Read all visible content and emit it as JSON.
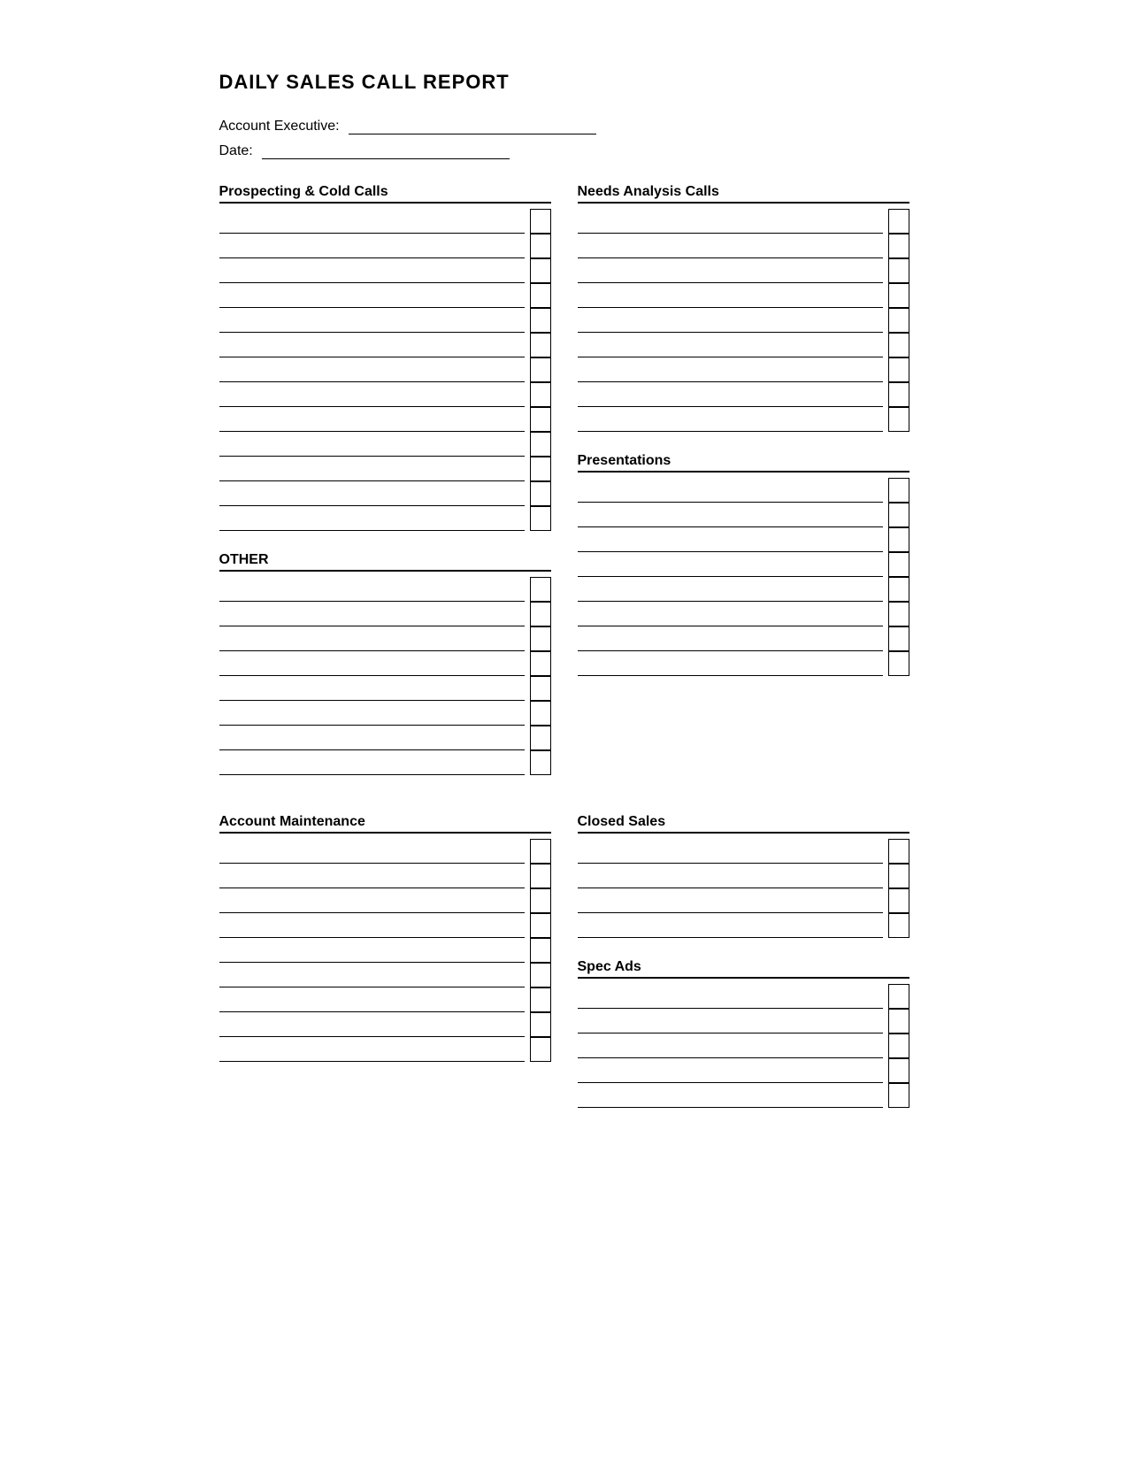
{
  "title": "DAILY SALES CALL REPORT",
  "header": {
    "account_executive_label": "Account Executive:",
    "date_label": "Date:"
  },
  "left_column": {
    "section1": {
      "title": "Prospecting & Cold Calls",
      "rows": 13
    },
    "section2": {
      "title": "OTHER",
      "rows": 8
    }
  },
  "right_column": {
    "section1": {
      "title": "Needs Analysis Calls",
      "rows": 9
    },
    "section2": {
      "title": "Presentations",
      "rows": 8
    }
  },
  "bottom_left": {
    "section1": {
      "title": "Account Maintenance",
      "rows": 9
    }
  },
  "bottom_right": {
    "section1": {
      "title": "Closed Sales",
      "rows": 4
    },
    "section2": {
      "title": "Spec Ads",
      "rows": 5
    }
  }
}
